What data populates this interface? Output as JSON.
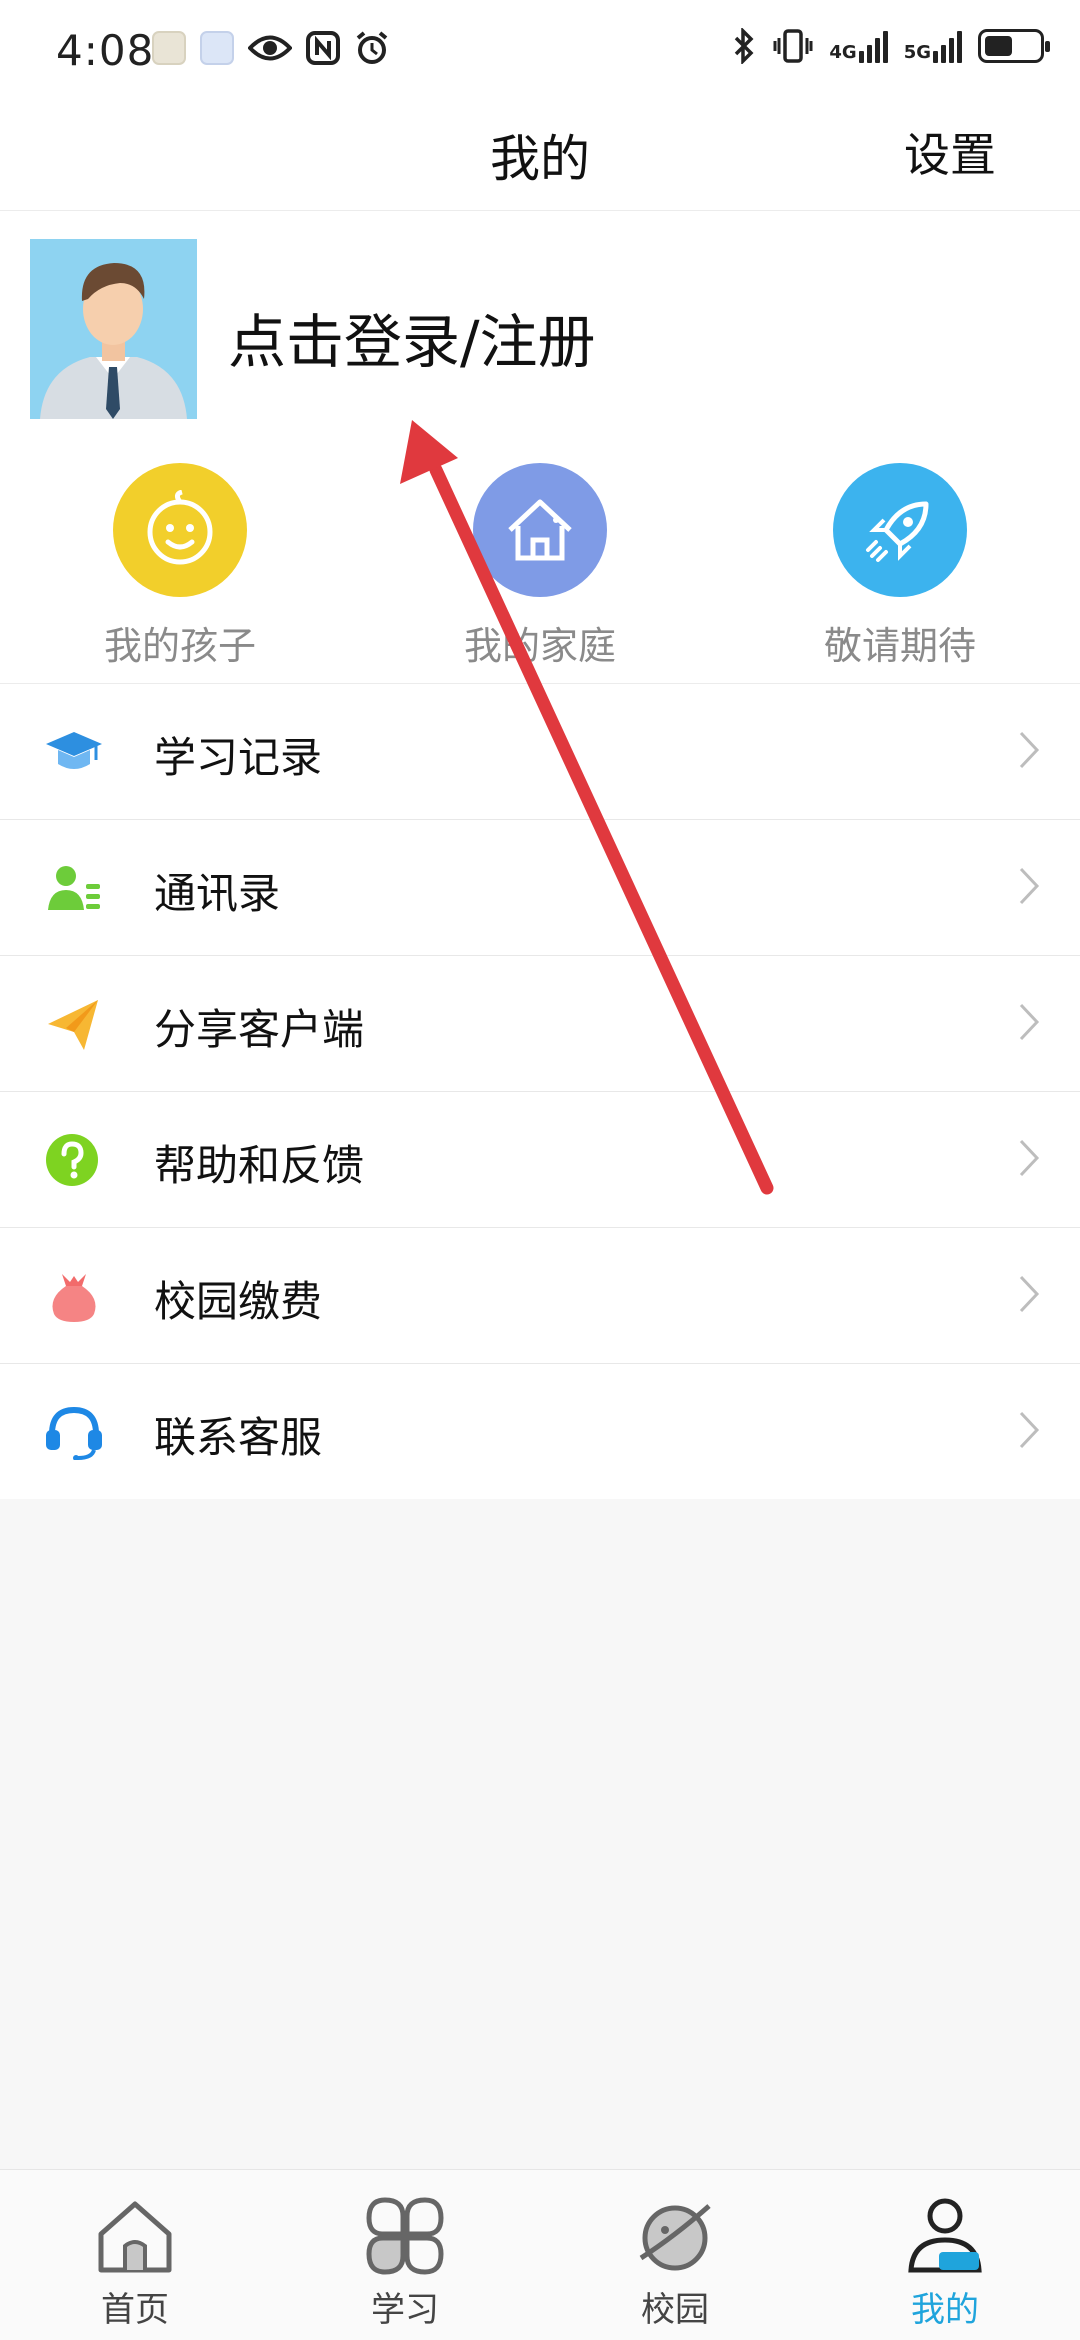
{
  "status_bar": {
    "time": "4:08",
    "network_1": "4G",
    "network_2": "5G",
    "icons": [
      "app-notification-icon",
      "app-notification-icon",
      "eye-icon",
      "nfc-icon",
      "alarm-icon",
      "bluetooth-icon",
      "vibrate-icon",
      "battery-icon"
    ]
  },
  "header": {
    "title": "我的",
    "settings_label": "设置"
  },
  "profile": {
    "login_text": "点击登录/注册"
  },
  "quick_entries": [
    {
      "label": "我的孩子",
      "icon": "baby-face-icon",
      "color": "#f2cf2b"
    },
    {
      "label": "我的家庭",
      "icon": "house-icon",
      "color": "#7f9be6"
    },
    {
      "label": "敬请期待",
      "icon": "rocket-icon",
      "color": "#3cb3ee"
    }
  ],
  "menu": [
    {
      "label": "学习记录",
      "icon": "graduation-cap-icon"
    },
    {
      "label": "通讯录",
      "icon": "contacts-icon"
    },
    {
      "label": "分享客户端",
      "icon": "paper-plane-icon"
    },
    {
      "label": "帮助和反馈",
      "icon": "help-icon"
    },
    {
      "label": "校园缴费",
      "icon": "money-bag-icon"
    },
    {
      "label": "联系客服",
      "icon": "headset-icon"
    }
  ],
  "bottom_nav": [
    {
      "label": "首页",
      "icon": "home-icon",
      "active": false
    },
    {
      "label": "学习",
      "icon": "grid-clover-icon",
      "active": false
    },
    {
      "label": "校园",
      "icon": "planet-icon",
      "active": false
    },
    {
      "label": "我的",
      "icon": "user-icon",
      "active": true
    }
  ],
  "colors": {
    "accent": "#1fa4dc",
    "arrow": "#e0393e"
  }
}
